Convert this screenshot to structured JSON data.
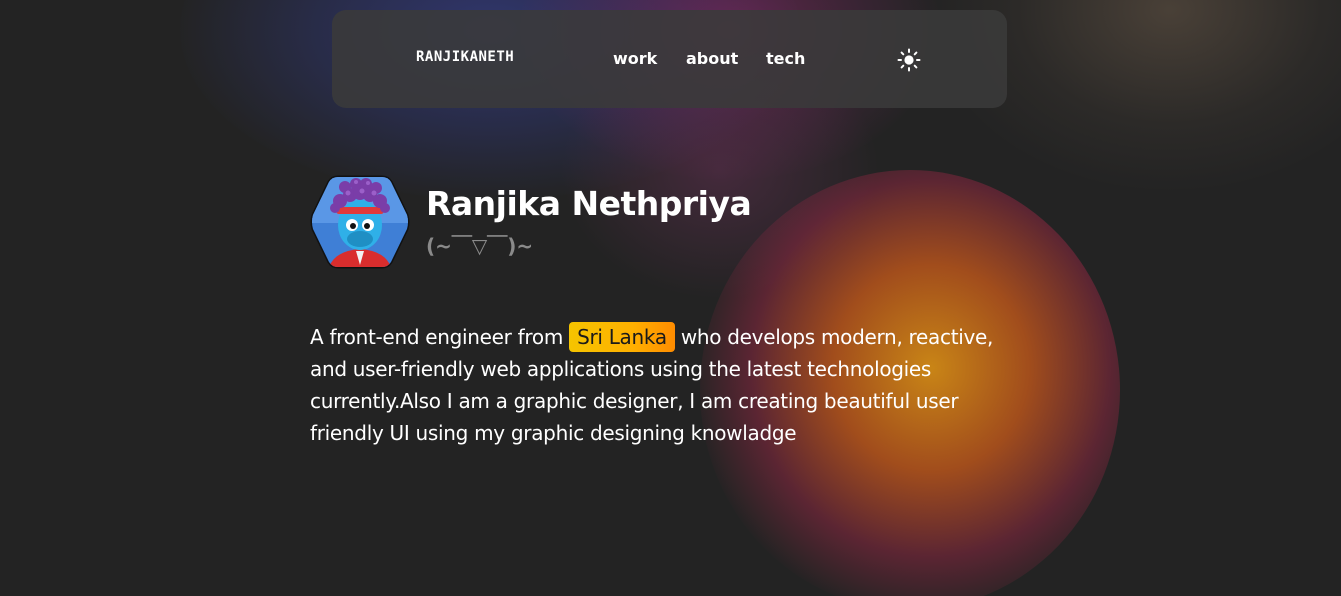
{
  "header": {
    "brand": "RANJIKANETH",
    "nav": [
      {
        "label": "work"
      },
      {
        "label": "about"
      },
      {
        "label": "tech"
      }
    ],
    "theme_icon": "sun-icon"
  },
  "profile": {
    "name": "Ranjika Nethpriya",
    "kaomoji": "(~￣▽￣)~",
    "avatar_icon": "avatar-character"
  },
  "bio": {
    "before": "A front-end engineer from ",
    "highlight": "Sri Lanka",
    "after": " who develops modern, reactive, and user-friendly web applications using the latest technologies currently.Also I am a graphic designer, I am creating beautiful user friendly UI using my graphic designing knowladge"
  },
  "colors": {
    "background": "#232323",
    "navbar": "#3a3a3a",
    "highlight_start": "#f5c400",
    "highlight_end": "#ff8c00",
    "muted_text": "#8a8a8a"
  }
}
